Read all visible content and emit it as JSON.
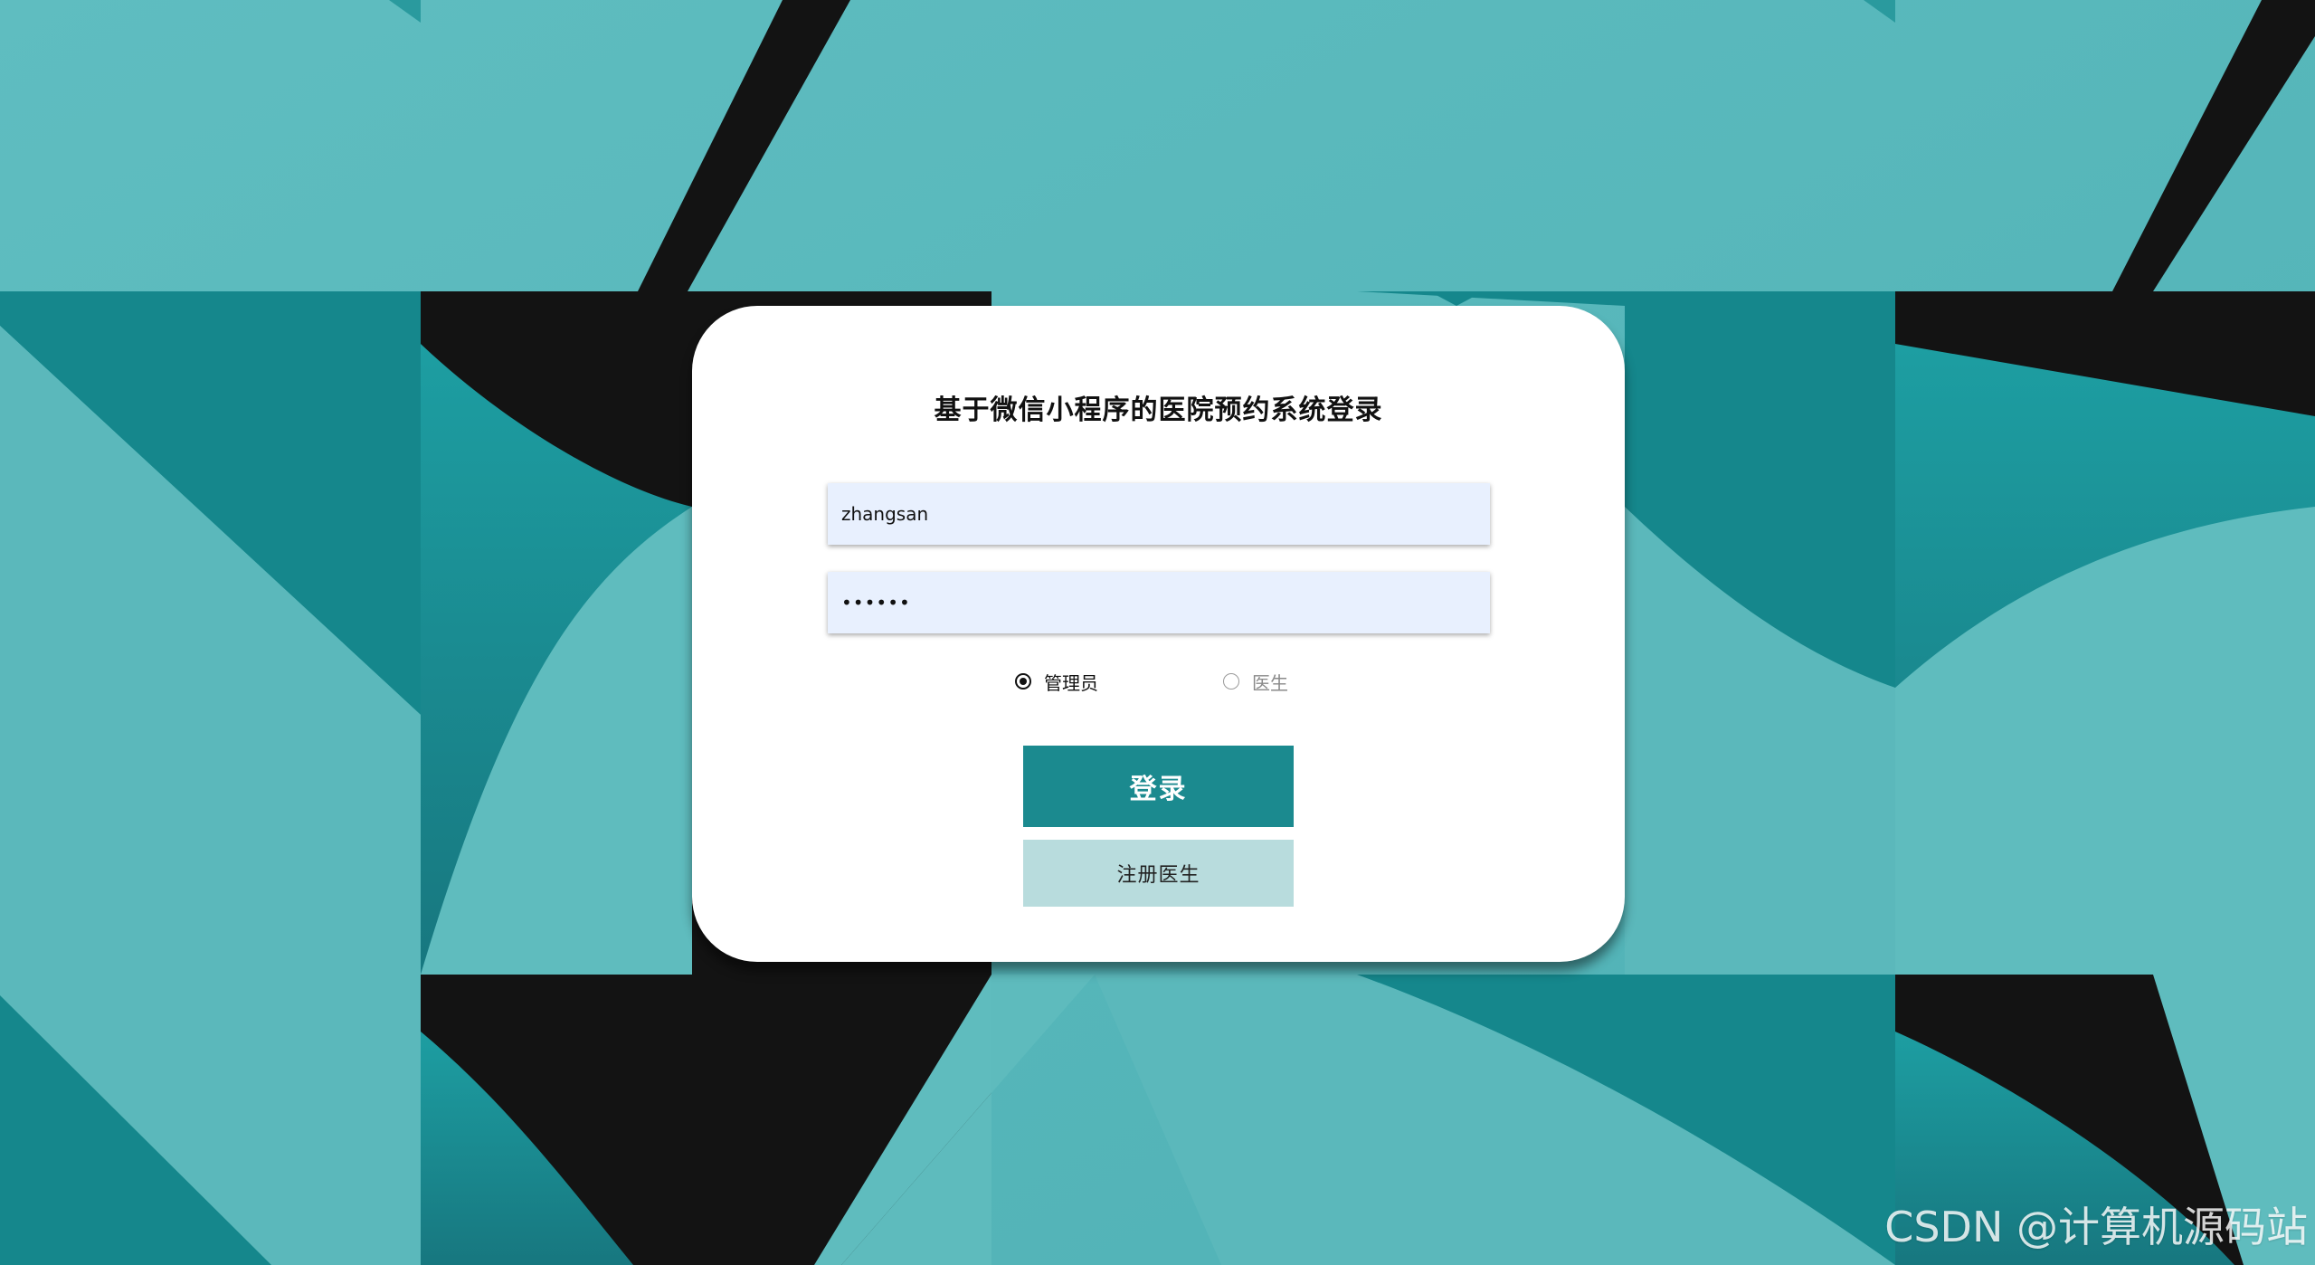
{
  "login": {
    "title": "基于微信小程序的医院预约系统登录",
    "username_value": "zhangsan",
    "password_value": "••••••",
    "roles": [
      {
        "label": "管理员",
        "selected": true
      },
      {
        "label": "医生",
        "selected": false
      }
    ],
    "login_button": "登录",
    "register_button": "注册医生"
  },
  "watermark": "CSDN @计算机源码站",
  "colors": {
    "primary": "#1b8a8f",
    "secondary_button": "#b8dcdd",
    "input_background": "#e8f0fe",
    "background_teal": "#5cb8bb",
    "background_dark": "#131313"
  }
}
